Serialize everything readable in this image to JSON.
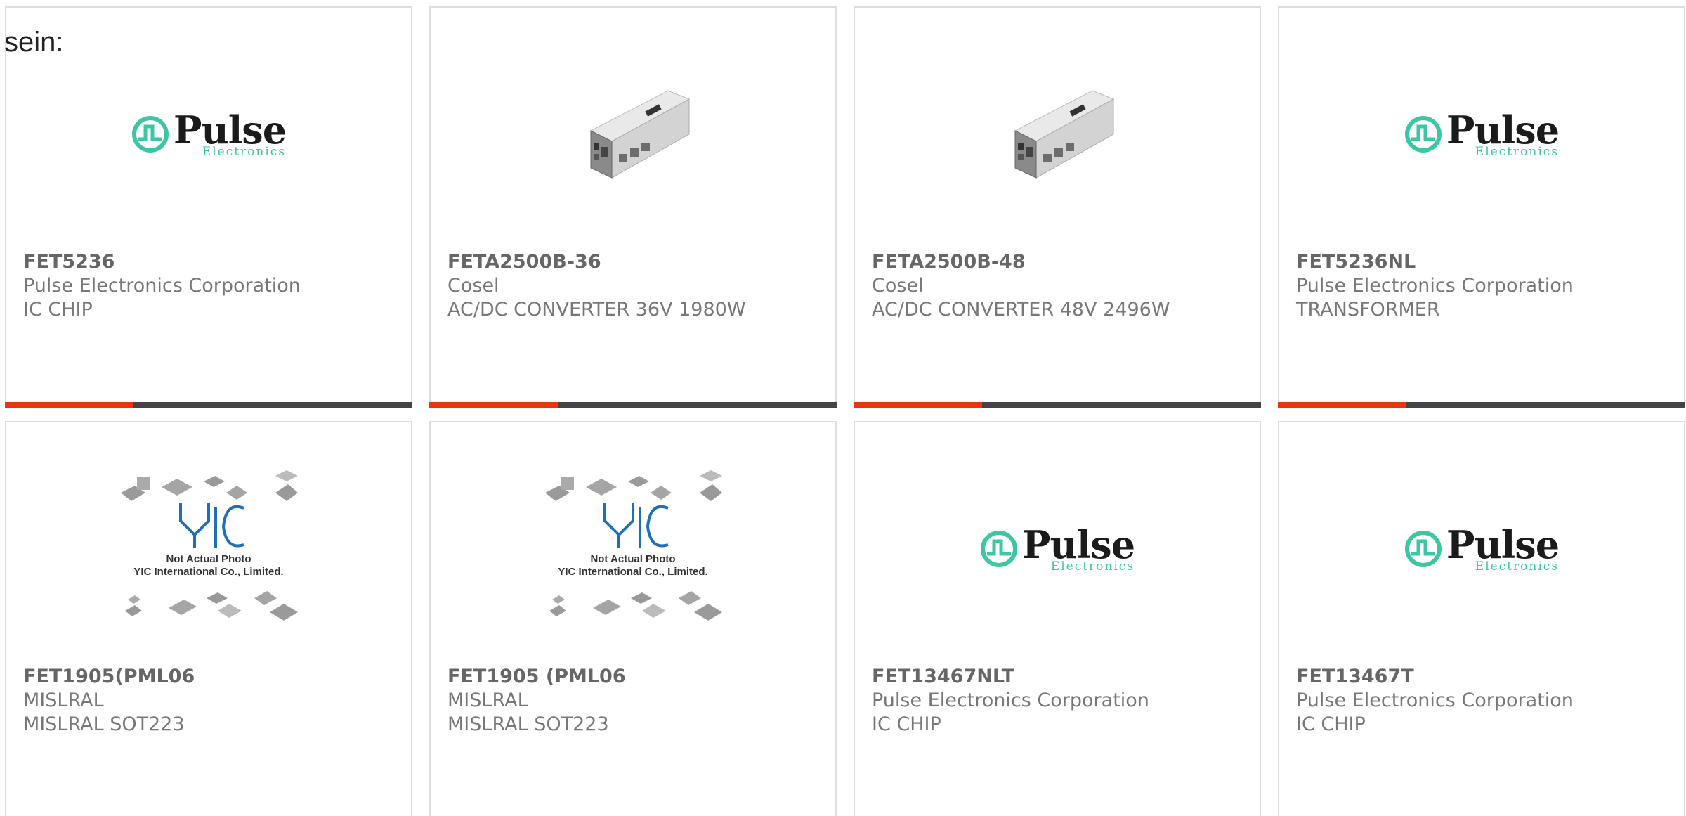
{
  "intro_text": "sein:",
  "colors": {
    "accent_bar": "#e8360e",
    "bar": "#444444",
    "pulse_green": "#3cc6a4",
    "yic_blue": "#1f6fb8"
  },
  "placeholder": {
    "caption_line1": "Not Actual Photo",
    "caption_line2": "YIC International Co., Limited."
  },
  "pulse_logo": {
    "word": "Pulse",
    "sub": "Electronics"
  },
  "products": [
    {
      "part": "FET5236",
      "manufacturer": "Pulse Electronics Corporation",
      "description": "IC CHIP",
      "image": "pulse-logo"
    },
    {
      "part": "FETA2500B-36",
      "manufacturer": "Cosel",
      "description": "AC/DC CONVERTER 36V 1980W",
      "image": "power-supply"
    },
    {
      "part": "FETA2500B-48",
      "manufacturer": "Cosel",
      "description": "AC/DC CONVERTER 48V 2496W",
      "image": "power-supply"
    },
    {
      "part": "FET5236NL",
      "manufacturer": "Pulse Electronics Corporation",
      "description": "TRANSFORMER",
      "image": "pulse-logo"
    },
    {
      "part": "FET1905(PML06",
      "manufacturer": "MISLRAL",
      "description": "MISLRAL SOT223",
      "image": "yic-placeholder"
    },
    {
      "part": "FET1905 (PML06",
      "manufacturer": "MISLRAL",
      "description": "MISLRAL SOT223",
      "image": "yic-placeholder"
    },
    {
      "part": "FET13467NLT",
      "manufacturer": "Pulse Electronics Corporation",
      "description": "IC CHIP",
      "image": "pulse-logo"
    },
    {
      "part": "FET13467T",
      "manufacturer": "Pulse Electronics Corporation",
      "description": "IC CHIP",
      "image": "pulse-logo"
    }
  ]
}
